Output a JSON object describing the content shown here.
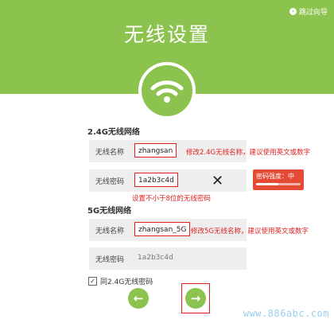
{
  "header": {
    "title": "无线设置",
    "skip_label": "跳过向导",
    "skip_icon": "arrow-right-circle-icon"
  },
  "colors": {
    "brand_green": "#8cc24e",
    "annotation_red": "#e02020",
    "strength_red": "#e44a34"
  },
  "band24": {
    "section_title": "2.4G无线网络",
    "ssid_label": "无线名称",
    "ssid_value": "zhangsan",
    "ssid_note": "修改2.4G无线名称，建议使用英文或数字",
    "password_label": "无线密码",
    "password_value": "1a2b3c4d",
    "password_note": "设置不小于8位的无线密码",
    "clear_icon": "x-icon",
    "strength_label": "密码强度：中",
    "strength_level": 0.5
  },
  "band5": {
    "section_title": "5G无线网络",
    "ssid_label": "无线名称",
    "ssid_value": "zhangsan_5G",
    "ssid_note": "修改5G无线名称，建议使用英文或数字",
    "password_label": "无线密码",
    "password_value": "1a2b3c4d"
  },
  "same_password": {
    "label": "同2.4G无线密码",
    "checked": true
  },
  "nav": {
    "prev_icon": "arrow-left-icon",
    "next_icon": "arrow-right-icon",
    "prev_glyph": "←",
    "next_glyph": "→"
  },
  "watermark": "www.886abc.com"
}
